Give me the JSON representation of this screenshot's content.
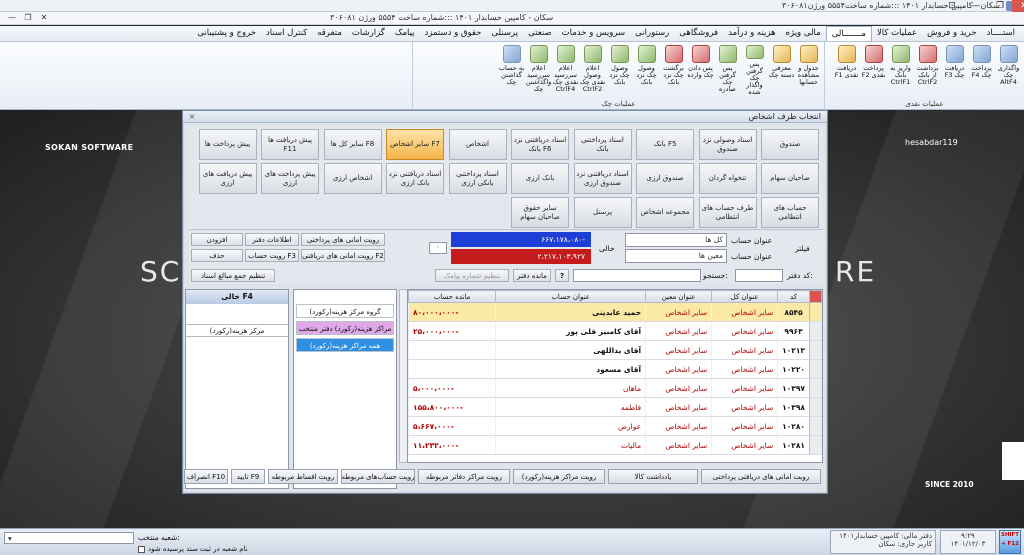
{
  "window": {
    "title": "سکان - کامپین حسابدار ۱۴۰۱ :::شماره ساخت۵۵۵۴ ورژن۳۰۶۰۸۱",
    "inner_title": "سکان - کامپین حسابدار ۱۴۰۱ :::شماره ساخت ۵۵۵۴ ورژن ۳۰۶۰۸۱",
    "controls": [
      "⊡",
      "—",
      "❐",
      "✕"
    ],
    "inner_controls": [
      "—",
      "❐",
      "✕"
    ]
  },
  "menu": {
    "items": [
      "استــــاد",
      "خرید و فروش",
      "عملیات کالا",
      "مـــــــالی",
      "مالی ویژه",
      "هزینه و درآمد",
      "فروشگاهی",
      "رستورانی",
      "سرویس و خدمات",
      "صنعتی",
      "پرسنلی",
      "حقوق و دستمزد",
      "پیامک",
      "گزارشات",
      "متفرقه",
      "کنترل اسناد",
      "خروج و پشتیبانی"
    ],
    "active_index": 3
  },
  "ribbon": {
    "group_left_label": "عملیات چک",
    "group_right_label": "عملیات نقدی",
    "left_buttons": [
      {
        "label": "جدول و مشاهده حسابها",
        "icon": "table-icon",
        "color": "y"
      },
      {
        "label": "معرفی دسته چک",
        "icon": "checkbook-icon",
        "color": "y"
      },
      {
        "label": "پس گرفتن چک واگذار شده",
        "icon": "check-return-icon",
        "color": "g"
      },
      {
        "label": "پس گرفتن چک صادره",
        "icon": "check-return-icon",
        "color": "g"
      },
      {
        "label": "پس دادن چک وارده",
        "icon": "check-return-icon",
        "color": "r"
      },
      {
        "label": "برگشت چک نزد بانک",
        "icon": "check-bounce-icon",
        "color": "r"
      },
      {
        "label": "وصول چک نزد بانک",
        "icon": "check-collect-icon",
        "color": "g"
      },
      {
        "label": "وصول چک نزد بانک",
        "icon": "check-collect-icon",
        "color": "g"
      },
      {
        "label": "اعلام وصول نقدی چک CtrlF2",
        "icon": "cash-check-icon",
        "color": "g"
      },
      {
        "label": "اعلام سررسید نقدی چک CtrlF4",
        "icon": "calendar-check-icon",
        "color": "g"
      },
      {
        "label": "اعلام سررسید واگذاشتن چک",
        "icon": "calendar-check-icon",
        "color": "g"
      },
      {
        "label": "به حساب گذاشتن چک",
        "icon": "deposit-check-icon",
        "color": "b"
      }
    ],
    "right_buttons": [
      {
        "label": "واگذاری چک AltF4",
        "icon": "assign-check-icon",
        "color": "b"
      },
      {
        "label": "پرداخت چک F4",
        "icon": "pay-check-icon",
        "color": "b"
      },
      {
        "label": "دریافت چک F3",
        "icon": "receive-check-icon",
        "color": "b"
      },
      {
        "label": "برداشت از بانک CtrlF2",
        "icon": "bank-withdraw-icon",
        "color": "r"
      },
      {
        "label": "واریز به بانک CtrlF1",
        "icon": "bank-deposit-icon",
        "color": "g"
      },
      {
        "label": "پرداخت نقدی F2",
        "icon": "cash-pay-icon",
        "color": "r"
      },
      {
        "label": "دریافت نقدی F1",
        "icon": "cash-receive-icon",
        "color": "y"
      }
    ]
  },
  "background": {
    "brand_left": "SOKAN SOFTWARE",
    "brand_right": "hesabdar119",
    "big_left": "SC",
    "big_right": "RE",
    "since": "SINCE 2010"
  },
  "dialog": {
    "title": "انتخاب طرف اشخاص",
    "close": "×",
    "person_buttons": [
      [
        "صندوق",
        "اسناد وصولی نزد صندوق",
        "بانک F5",
        "اسناد پرداختنی بانک",
        "اسناد دریافتنی نزد بانک F6",
        "اشخاص",
        "سایر اشخاص F7",
        "سایر کل ها F8",
        "پیش دریافت ها F11",
        "پیش پرداخت ها"
      ],
      [
        "صاحبان سهام",
        "تنخواه گردان",
        "صندوق ارزی",
        "اسناد دریافتنی نزد صندوق ارزی",
        "بانک ارزی",
        "اسناد پرداختنی بانکی ارزی",
        "اسناد دریافتنی نزد بانک ارزی",
        "اشخاص ارزی",
        "پیش پرداخت های ارزی",
        "پیش دریافت های ارزی"
      ],
      [
        "حساب های انتظامی",
        "طرف حساب های انتظامی",
        "مجموعه اشخاص",
        "پرسنل",
        "سایر حقوق صاحبان سهام"
      ]
    ],
    "selected_person": "سایر اشخاص F7",
    "filter": {
      "label": "فیلتر",
      "account_title_label": "عنوان حساب",
      "account_title_value_1": "کل ها",
      "account_title_value_2": "معین ها",
      "empty_label": "خالی",
      "blue_value": "۶۶۷،۱۷۸،۰۸۰-",
      "red_value": "۲،۲۱۷،۱۰۳،۹۲۷",
      "zero_value": "۰"
    },
    "actions": {
      "pay_certificates": "رویت امانی های پرداختی",
      "recv_certificates": "رویت امانی های دریافتی F2",
      "notebook_info": "اطلاعات دفتر",
      "account_view": "رویت حساب F3",
      "add": "افزودن",
      "delete": "حذف",
      "amounts_setting": "تنظیم جمع مبالغ اسناد",
      "sms_setting": "تنظیم شماره پیامک",
      "notebook_balance": "مانده دفتر",
      "help": "?",
      "search_label": "جستجو:",
      "code_label": "کد دفتر:"
    },
    "grid": {
      "columns": [
        "کد",
        "عنوان کل",
        "عنوان معین",
        "عنوان حساب",
        "مانده حساب"
      ],
      "rows": [
        {
          "code": "۸۵۴۵",
          "kol": "سایر اشخاص",
          "moin": "سایر اشخاص",
          "title": "حمید عابدینی",
          "balance": "۸۰،۰۰۰،۰۰۰-",
          "selected": true
        },
        {
          "code": "۹۹۶۳",
          "kol": "سایر اشخاص",
          "moin": "سایر اشخاص",
          "title": "آقای کامبیز فلی پور",
          "balance": "۲۵،۰۰۰،۰۰۰-",
          "selected": false
        },
        {
          "code": "۱۰۲۱۳",
          "kol": "سایر اشخاص",
          "moin": "سایر اشخاص",
          "title": "آقای یداللهی",
          "balance": "",
          "selected": false
        },
        {
          "code": "۱۰۲۲۰",
          "kol": "سایر اشخاص",
          "moin": "سایر اشخاص",
          "title": "آقای مسعود",
          "balance": "",
          "selected": false
        },
        {
          "code": "۱۰۳۹۷",
          "kol": "سایر اشخاص",
          "moin": "سایر اشخاص",
          "title": "ماهان",
          "balance": "۵،۰۰۰،۰۰۰-",
          "selected": false
        },
        {
          "code": "۱۰۳۹۸",
          "kol": "سایر اشخاص",
          "moin": "سایر اشخاص",
          "title": "فاطمه",
          "balance": "۱۵۵،۸۰۰،۰۰۰-",
          "selected": false
        },
        {
          "code": "۱۰۲۸۰",
          "kol": "سایر اشخاص",
          "moin": "سایر اشخاص",
          "title": "عوارض",
          "balance": "۵،۶۶۷،۰۰۰-",
          "selected": false
        },
        {
          "code": "۱۰۲۸۱",
          "kol": "سایر اشخاص",
          "moin": "سایر اشخاص",
          "title": "مالیات",
          "balance": "۱۱،۲۳۲،۰۰۰-",
          "selected": false
        }
      ]
    },
    "cost_centers": {
      "items": [
        "گروه مرکز هزینه(رکورد)",
        "مراکز هزینه(رکورد) دفتر منتخب",
        "همه مراکز هزینه(رکورد)"
      ],
      "left_header": "خالی F4",
      "left_sub": "مرکز هزینه(رکورد)"
    },
    "bottom_buttons": [
      "رویت امانی های دریافتی پرداختی",
      "یادداشت کالا",
      "رویت مراکز هزینه(رکورد)",
      "رویت مراکز دفاتر مربوطه",
      "رویت حساب‌های مربوطه",
      "رویت اقساط مربوطه",
      "تایید F9",
      "انصراف F10"
    ]
  },
  "status": {
    "branch_label": "شعبه منتخب:",
    "branch_checkbox": "نام شعبه در ثبت سند پرسیده شود",
    "fiscal": "دفتر مالی: کامپین حسابدار۱۴۰۱",
    "user": "کاربر جاری: سکان",
    "time": "۹:۲۹",
    "date": "۱۴۰۱/۱۲/۰۳",
    "shift": "SHIFT + F12"
  }
}
